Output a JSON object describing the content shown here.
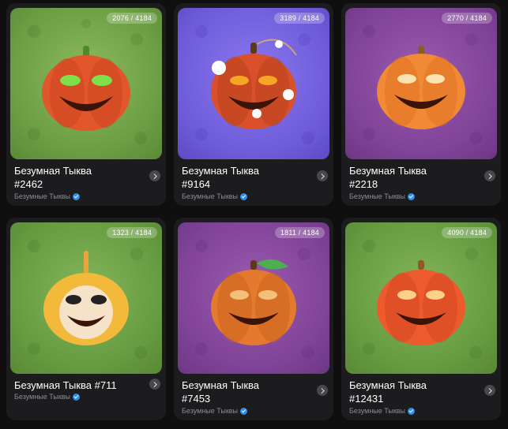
{
  "cards": [
    {
      "count": "2076 / 4184",
      "title1": "Безумная Тыква",
      "title2": "#2462",
      "collection": "Безумные Тыквы",
      "bg": "green",
      "pumpkin_color": "#e2562b",
      "eyes_color": "#7ee04a"
    },
    {
      "count": "3189 / 4184",
      "title1": "Безумная Тыква",
      "title2": "#9164",
      "collection": "Безумные Тыквы",
      "bg": "violet",
      "pumpkin_color": "#d9502a",
      "eyes_color": "#f5a623"
    },
    {
      "count": "2770 / 4184",
      "title1": "Безумная Тыква",
      "title2": "#2218",
      "collection": "Безумные Тыквы",
      "bg": "purple",
      "pumpkin_color": "#f08a35",
      "eyes_color": "#fbe3b0"
    },
    {
      "count": "1323 / 4184",
      "title1": "Безумная Тыква #711",
      "title2": "",
      "collection": "Безумные Тыквы",
      "bg": "green2",
      "pumpkin_color": "#f2b93b",
      "eyes_color": "#222222"
    },
    {
      "count": "1811 / 4184",
      "title1": "Безумная Тыква",
      "title2": "#7453",
      "collection": "Безумные Тыквы",
      "bg": "purple",
      "pumpkin_color": "#e57a2e",
      "eyes_color": "#f3c07a"
    },
    {
      "count": "4090 / 4184",
      "title1": "Безумная Тыква",
      "title2": "#12431",
      "collection": "Безумные Тыквы",
      "bg": "green2",
      "pumpkin_color": "#ee5a2c",
      "eyes_color": "#ffd08a"
    }
  ]
}
